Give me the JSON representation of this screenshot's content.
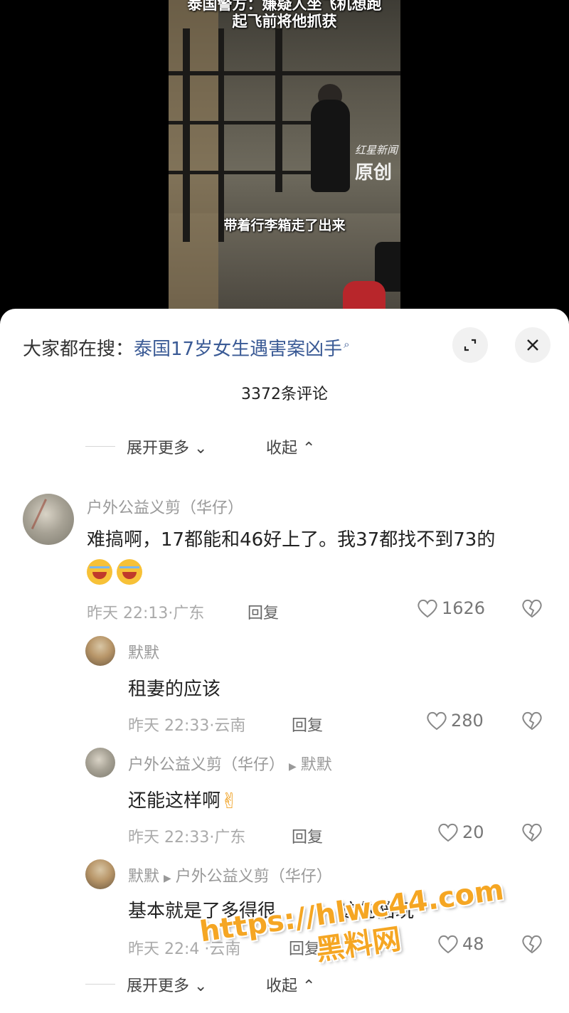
{
  "video": {
    "title_line1": "泰国警方：嫌疑人坐飞机想跑",
    "title_line2": "起飞前将他抓获",
    "subtitle": "带着行李箱走了出来",
    "watermark_small": "红星新闻",
    "watermark_big": "原创"
  },
  "sheet": {
    "search_prefix": "大家都在搜：",
    "search_keyword": "泰国17岁女生遇害案凶手",
    "comment_count": "3372条评论",
    "expand_more": "展开更多",
    "collapse": "收起"
  },
  "comments": [
    {
      "username": "户外公益义剪（华仔）",
      "text": "难搞啊，17都能和46好上了。我37都找不到73的",
      "time": "昨天 22:13",
      "location": "广东",
      "reply_label": "回复",
      "likes": "1626"
    },
    {
      "username": "默默",
      "text": "租妻的应该",
      "time": "昨天 22:33",
      "location": "云南",
      "reply_label": "回复",
      "likes": "280"
    },
    {
      "username": "户外公益义剪（华仔）",
      "reply_to": "默默",
      "text": "还能这样啊",
      "time": "昨天 22:33",
      "location": "广东",
      "reply_label": "回复",
      "likes": "20"
    },
    {
      "username": "默默",
      "reply_to": "户外公益义剪（华仔）",
      "text": "基本就是了多得很",
      "text_end": "这的陪玩",
      "time": "昨天 22:4",
      "location": "云南",
      "reply_label": "回复",
      "likes": "48"
    }
  ],
  "footer": {
    "expand_more": "展开更多",
    "collapse": "收起"
  },
  "watermark": {
    "url": "https://hlwc44.com",
    "name": "黑料网"
  },
  "colors": {
    "keyword": "#3a5a95",
    "watermark": "#f5a623"
  }
}
